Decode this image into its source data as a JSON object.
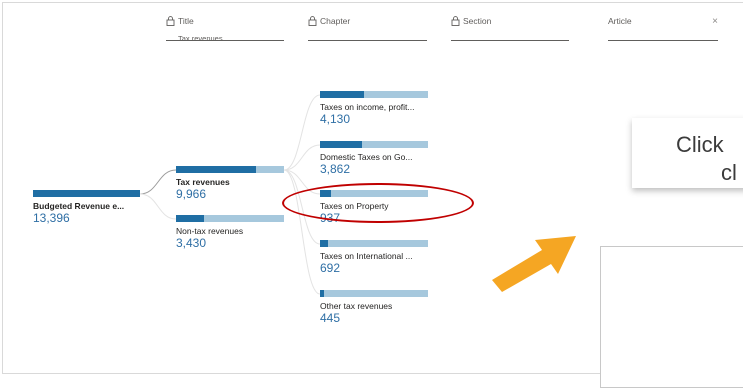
{
  "levels": [
    {
      "label": "Title",
      "sub": "Tax revenues",
      "locked": true
    },
    {
      "label": "Chapter",
      "sub": "",
      "locked": true
    },
    {
      "label": "Section",
      "sub": "",
      "locked": true
    },
    {
      "label": "Article",
      "sub": "",
      "locked": false,
      "close": "×"
    }
  ],
  "root": {
    "label": "Budgeted Revenue e...",
    "value": "13,396",
    "fill": 1.0
  },
  "level1": [
    {
      "label": "Tax revenues",
      "value": "9,966",
      "fill": 0.74,
      "bold": true
    },
    {
      "label": "Non-tax revenues",
      "value": "3,430",
      "fill": 0.26,
      "bold": false
    }
  ],
  "level2": [
    {
      "label": "Taxes on income, profit...",
      "value": "4,130",
      "fill": 0.41
    },
    {
      "label": "Domestic Taxes on Go...",
      "value": "3,862",
      "fill": 0.39
    },
    {
      "label": "Taxes on Property",
      "value": "937",
      "fill": 0.1
    },
    {
      "label": "Taxes on International ...",
      "value": "692",
      "fill": 0.07
    },
    {
      "label": "Other tax revenues",
      "value": "445",
      "fill": 0.04
    }
  ],
  "callout": {
    "line1": "Click",
    "line2": "cl"
  },
  "colors": {
    "bar_fill": "#1f6ea4",
    "bar_track": "#a6c8dd",
    "value_text": "#2f6fa5",
    "highlight": "#c00000",
    "arrow": "#f5a623"
  }
}
